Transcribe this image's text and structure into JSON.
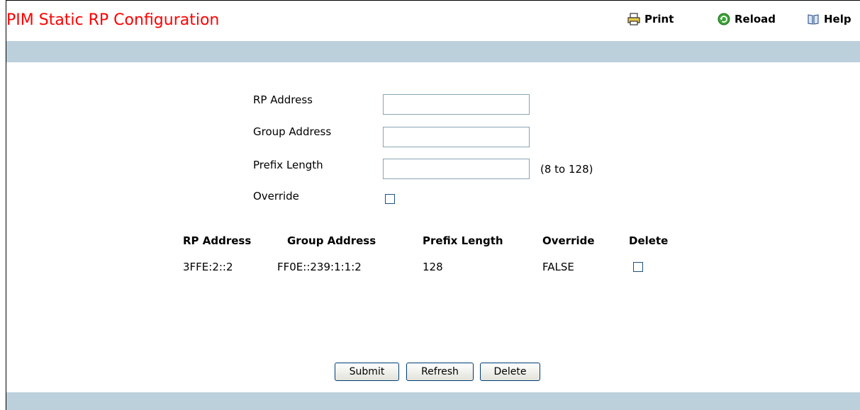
{
  "page": {
    "title": "PIM Static RP Configuration"
  },
  "toolbar": {
    "print_label": "Print",
    "reload_label": "Reload",
    "help_label": "Help"
  },
  "form": {
    "rp_address_label": "RP Address",
    "rp_address_value": "",
    "group_address_label": "Group Address",
    "group_address_value": "",
    "prefix_length_label": "Prefix Length",
    "prefix_length_value": "",
    "prefix_length_hint": "(8 to 128)",
    "override_label": "Override",
    "override_checked": false
  },
  "table": {
    "headers": [
      "RP Address",
      "Group Address",
      "Prefix Length",
      "Override",
      "Delete"
    ],
    "rows": [
      {
        "rp_address": "3FFE:2::2",
        "group_address": "FF0E::239:1:1:2",
        "prefix_length": "128",
        "override": "FALSE",
        "delete_checked": false
      }
    ]
  },
  "buttons": {
    "submit": "Submit",
    "refresh": "Refresh",
    "delete": "Delete"
  },
  "colors": {
    "title": "#ff0000",
    "band": "#bcd0dc"
  }
}
